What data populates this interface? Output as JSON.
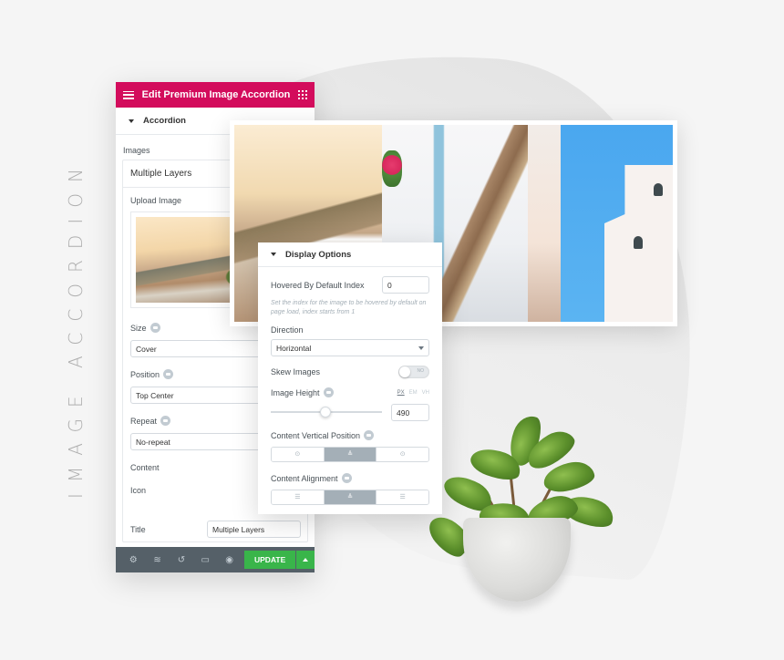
{
  "vertical_title": "IMAGE ACCORDION",
  "editor": {
    "header_title": "Edit Premium Image Accordion",
    "menu_icon": "hamburger-icon",
    "apps_icon": "grid-icon",
    "section_title": "Accordion",
    "images_label": "Images",
    "repeater_item_title": "Multiple Layers",
    "upload_label": "Upload Image",
    "fields": [
      {
        "label": "Size",
        "value": "Cover"
      },
      {
        "label": "Position",
        "value": "Top Center"
      },
      {
        "label": "Repeat",
        "value": "No-repeat"
      }
    ],
    "content_label": "Content",
    "icon_label": "Icon",
    "title_label": "Title",
    "title_value": "Multiple Layers",
    "footer": {
      "icons": [
        "gear-icon",
        "layers-icon",
        "history-icon",
        "desktop-icon",
        "eye-icon"
      ],
      "update_label": "UPDATE"
    }
  },
  "display_options": {
    "section_title": "Display Options",
    "hovered_index_label": "Hovered By Default Index",
    "hovered_index_value": "0",
    "hovered_index_help": "Set the index for the image to be hovered by default on page load, index starts from 1",
    "direction_label": "Direction",
    "direction_value": "Horizontal",
    "skew_label": "Skew Images",
    "skew_value": "NO",
    "skew_enabled": false,
    "image_height_label": "Image Height",
    "units": [
      "PX",
      "EM",
      "VH"
    ],
    "active_unit": "PX",
    "image_height_value": "490",
    "image_height_slider_fraction": 0.49,
    "content_vertical_position_label": "Content Vertical Position",
    "content_vertical_position_options": [
      "top",
      "middle",
      "bottom"
    ],
    "content_vertical_position_active": "middle",
    "content_alignment_label": "Content Alignment",
    "content_alignment_options": [
      "left",
      "center",
      "right"
    ],
    "content_alignment_active": "center"
  },
  "accordion_images": [
    "terrace-sunset",
    "white-house-stairs",
    "narrow-wall",
    "church-bell-tower"
  ],
  "colors": {
    "brand": "#d30c5c",
    "update_button": "#39b54a",
    "footer_bg": "#556068"
  }
}
